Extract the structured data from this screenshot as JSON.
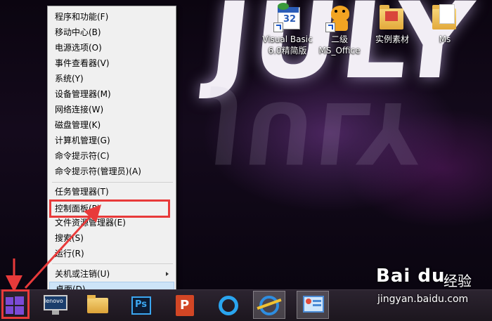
{
  "desktop": {
    "wallpaper_text": "JULY",
    "icons": [
      {
        "label_line1": "Visual Basic",
        "label_line2": "6.0精简版",
        "icon": "vb-calendar-icon",
        "shortcut": true
      },
      {
        "label_line1": "二级",
        "label_line2": "MS_Office",
        "icon": "tiger-icon",
        "shortcut": true
      },
      {
        "label_line1": "实例素材",
        "label_line2": "",
        "icon": "folder-icon",
        "shortcut": false
      },
      {
        "label_line1": "Ms",
        "label_line2": "",
        "icon": "folder-doc-icon",
        "shortcut": false
      }
    ]
  },
  "menu": {
    "groups": [
      [
        "程序和功能(F)",
        "移动中心(B)",
        "电源选项(O)",
        "事件查看器(V)",
        "系统(Y)",
        "设备管理器(M)",
        "网络连接(W)",
        "磁盘管理(K)",
        "计算机管理(G)",
        "命令提示符(C)",
        "命令提示符(管理员)(A)"
      ],
      [
        "任务管理器(T)",
        "控制面板(P)",
        "文件资源管理器(E)",
        "搜索(S)",
        "运行(R)"
      ],
      [
        "关机或注销(U)",
        "桌面(D)"
      ]
    ],
    "highlighted": "控制面板(P)",
    "hovered": "桌面(D)"
  },
  "taskbar": {
    "start_label": "开始",
    "apps": [
      "lenovo-monitor-icon",
      "file-explorer-icon",
      "photoshop-icon",
      "powerpoint-icon",
      "qq-browser-icon",
      "internet-explorer-icon",
      "control-panel-icon"
    ],
    "ps_text": "Ps",
    "ppt_text": "P",
    "lenovo_text": "lenovo"
  },
  "watermark": {
    "brand": "Bai du",
    "jingyan": "经验",
    "domain": "jingyan.baidu.com"
  },
  "colors": {
    "annotation_red": "#e83a3a",
    "menu_bg": "#f0f0f0",
    "hover_bg": "#cde4f7",
    "start_purple": "#7b4ad6"
  }
}
